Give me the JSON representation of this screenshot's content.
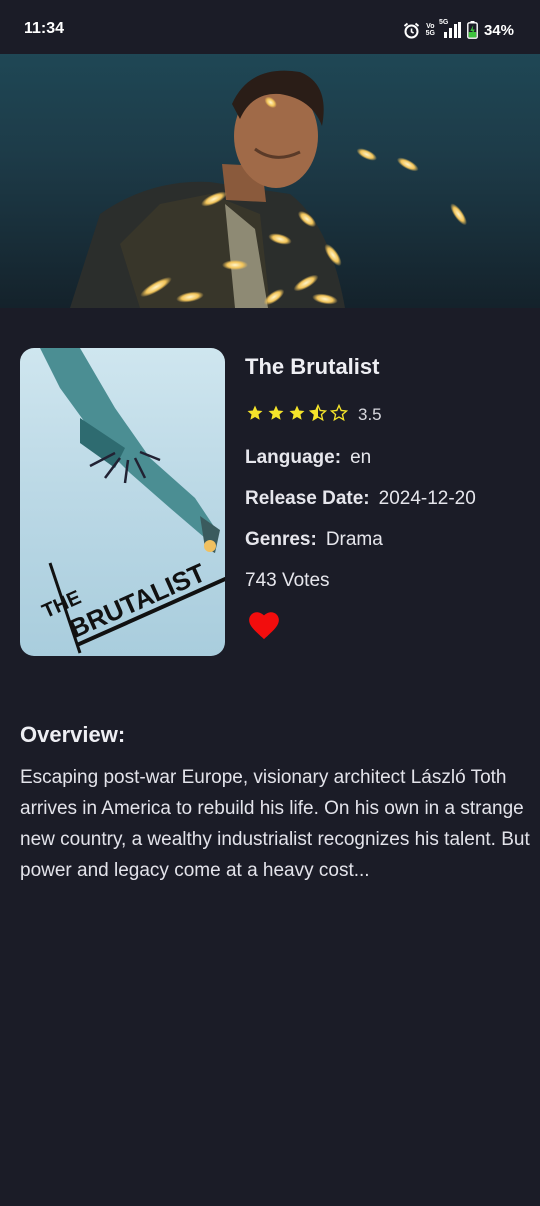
{
  "status": {
    "time": "11:34",
    "network_top": "Vo",
    "network_bottom": "5G",
    "signal_label": "5G",
    "battery": "34%"
  },
  "movie": {
    "title": "The Brutalist",
    "rating": "3.5",
    "rating_fraction": 0.7,
    "language_label": "Language:",
    "language": "en",
    "release_label": "Release Date:",
    "release_date": "2024-12-20",
    "genres_label": "Genres:",
    "genres": "Drama",
    "votes": "743 Votes",
    "favorite": true
  },
  "poster": {
    "title_small": "THE",
    "title_big": "BRUTALIST"
  },
  "overview": {
    "heading": "Overview:",
    "text": "Escaping post-war Europe, visionary architect László Toth arrives in America to rebuild his life. On his own in a strange new country, a wealthy industrialist recognizes his talent. But power and legacy come at a heavy cost..."
  },
  "colors": {
    "background": "#1b1c27",
    "star": "#f5e42a",
    "heart": "#f20d0d"
  },
  "icons": [
    "alarm-icon",
    "signal-icon",
    "battery-icon",
    "star-icon",
    "half-star-icon",
    "empty-star-icon",
    "heart-icon"
  ]
}
